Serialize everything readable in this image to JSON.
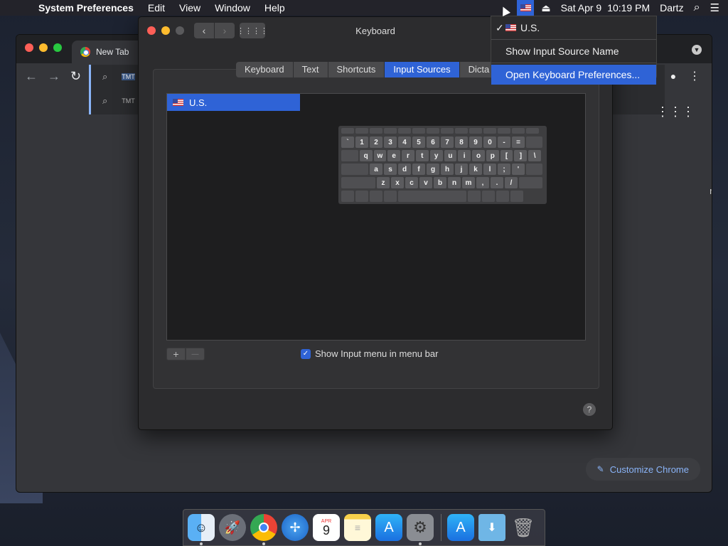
{
  "menubar": {
    "apple": "",
    "app_name": "System Preferences",
    "items": [
      "Edit",
      "View",
      "Window",
      "Help"
    ],
    "date": "Sat Apr 9",
    "time": "10:19 PM",
    "user": "Dartz",
    "eject_icon": "⏏",
    "search_icon": "⌕",
    "list_icon": "☰"
  },
  "chrome": {
    "tab_title": "New Tab",
    "omnibox_text": "TMT",
    "suggestion_text": "TMT",
    "customize_label": "Customize Chrome",
    "side_text": "m"
  },
  "prefs": {
    "title": "Keyboard",
    "tabs": [
      {
        "label": "Keyboard",
        "active": false
      },
      {
        "label": "Text",
        "active": false
      },
      {
        "label": "Shortcuts",
        "active": false
      },
      {
        "label": "Input Sources",
        "active": true
      },
      {
        "label": "Dicta",
        "active": false
      }
    ],
    "sources": [
      {
        "label": "U.S."
      }
    ],
    "add_label": "+",
    "remove_label": "—",
    "show_input_menu_label": "Show Input menu in menu bar",
    "show_input_menu_checked": true,
    "help_label": "?",
    "keyboard_rows": [
      [
        "`",
        "1",
        "2",
        "3",
        "4",
        "5",
        "6",
        "7",
        "8",
        "9",
        "0",
        "-",
        "="
      ],
      [
        "q",
        "w",
        "e",
        "r",
        "t",
        "y",
        "u",
        "i",
        "o",
        "p",
        "[",
        "]",
        "\\"
      ],
      [
        "a",
        "s",
        "d",
        "f",
        "g",
        "h",
        "j",
        "k",
        "l",
        ";",
        "'"
      ],
      [
        "z",
        "x",
        "c",
        "v",
        "b",
        "n",
        "m",
        ",",
        ".",
        "/"
      ]
    ]
  },
  "input_menu": {
    "items": [
      {
        "label": "U.S.",
        "checked": true
      },
      {
        "label": "Show Input Source Name"
      },
      {
        "label": "Open Keyboard Preferences...",
        "highlighted": true
      }
    ]
  },
  "dock": {
    "calendar_day": "9",
    "calendar_month": "APR"
  },
  "colors": {
    "accent": "#2f63d6",
    "chrome_link": "#8ab4f8"
  }
}
